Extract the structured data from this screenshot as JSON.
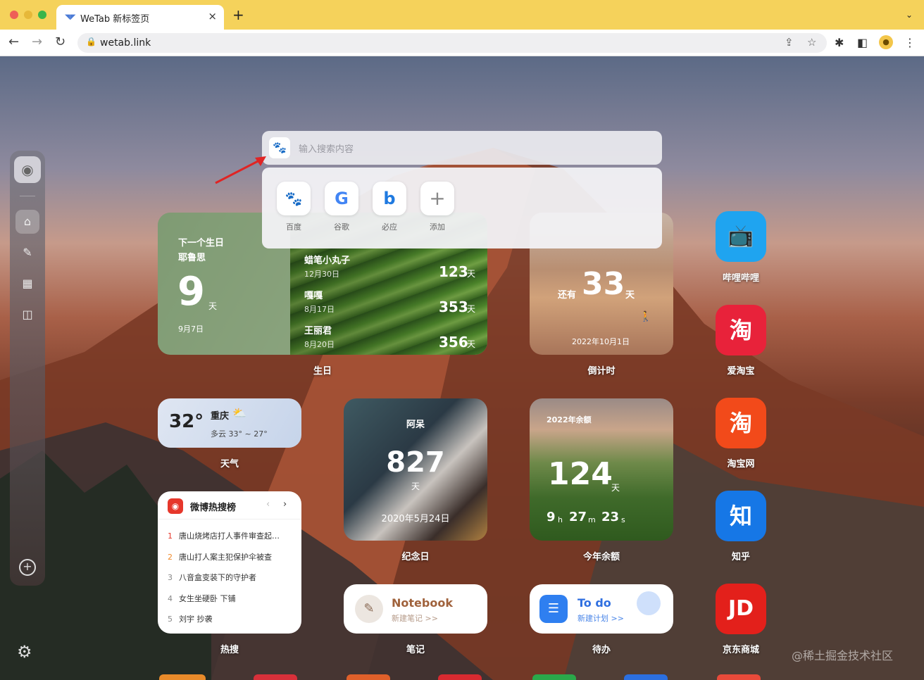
{
  "browser": {
    "tab_title": "WeTab 新标签页",
    "tab_favicon": "wetab-icon",
    "tab_close": "×",
    "new_tab": "+",
    "url": "wetab.link"
  },
  "search": {
    "placeholder": "输入搜索内容",
    "engines": [
      {
        "label": "百度",
        "glyph": "🐾",
        "color": "#2a54d6"
      },
      {
        "label": "谷歌",
        "glyph": "G",
        "color": "#4285f4"
      },
      {
        "label": "必应",
        "glyph": "b",
        "color": "#1f7ae0"
      },
      {
        "label": "添加",
        "glyph": "+",
        "color": "#888888"
      }
    ]
  },
  "birthday": {
    "header": "下一个生日",
    "name": "耶鲁思",
    "days": "9",
    "unit": "天",
    "date": "9月7日",
    "list": [
      {
        "name": "蜡笔小丸子",
        "date": "12月30日",
        "days": "123",
        "unit": "天"
      },
      {
        "name": "嘎嘎",
        "date": "8月17日",
        "days": "353",
        "unit": "天"
      },
      {
        "name": "王丽君",
        "date": "8月20日",
        "days": "356",
        "unit": "天"
      }
    ],
    "caption": "生日"
  },
  "countdown": {
    "prefix": "还有",
    "days": "33",
    "unit": "天",
    "date": "2022年10月1日",
    "caption": "倒计时"
  },
  "weather": {
    "temp": "32°",
    "city": "重庆",
    "desc": "多云 33° ~ 27°",
    "caption": "天气"
  },
  "anniversary": {
    "name": "阿呆",
    "days": "827",
    "unit": "天",
    "date": "2020年5月24日",
    "caption": "纪念日"
  },
  "year_remaining": {
    "title": "2022年余额",
    "days": "124",
    "unit": "天",
    "h": "9",
    "h_unit": "h",
    "m": "27",
    "m_unit": "m",
    "s": "23",
    "s_unit": "s",
    "caption": "今年余额"
  },
  "weibo": {
    "title": "微博热搜榜",
    "items": [
      {
        "rank": "1",
        "text": "唐山烧烤店打人事件审查起…"
      },
      {
        "rank": "2",
        "text": "唐山打人案主犯保护伞被查"
      },
      {
        "rank": "3",
        "text": "八音盒变装下的守护者"
      },
      {
        "rank": "4",
        "text": "女生坐硬卧 下铺"
      },
      {
        "rank": "5",
        "text": "刘宇 抄袭"
      }
    ],
    "caption": "热搜"
  },
  "notebook": {
    "title": "Notebook",
    "sub": "新建笔记 >>",
    "caption": "笔记"
  },
  "todo": {
    "title": "To do",
    "sub": "新建计划 >>",
    "caption": "待办"
  },
  "apps": [
    {
      "label": "哔哩哔哩",
      "glyph": "📺",
      "color": "#1fa4f0"
    },
    {
      "label": "爱淘宝",
      "glyph": "淘",
      "color": "#e8223a"
    },
    {
      "label": "淘宝网",
      "glyph": "淘",
      "color": "#f24a1a"
    },
    {
      "label": "知乎",
      "glyph": "知",
      "color": "#1677e6"
    },
    {
      "label": "京东商城",
      "glyph": "JD",
      "color": "#e3201b"
    }
  ],
  "watermark": "@稀土掘金技术社区"
}
